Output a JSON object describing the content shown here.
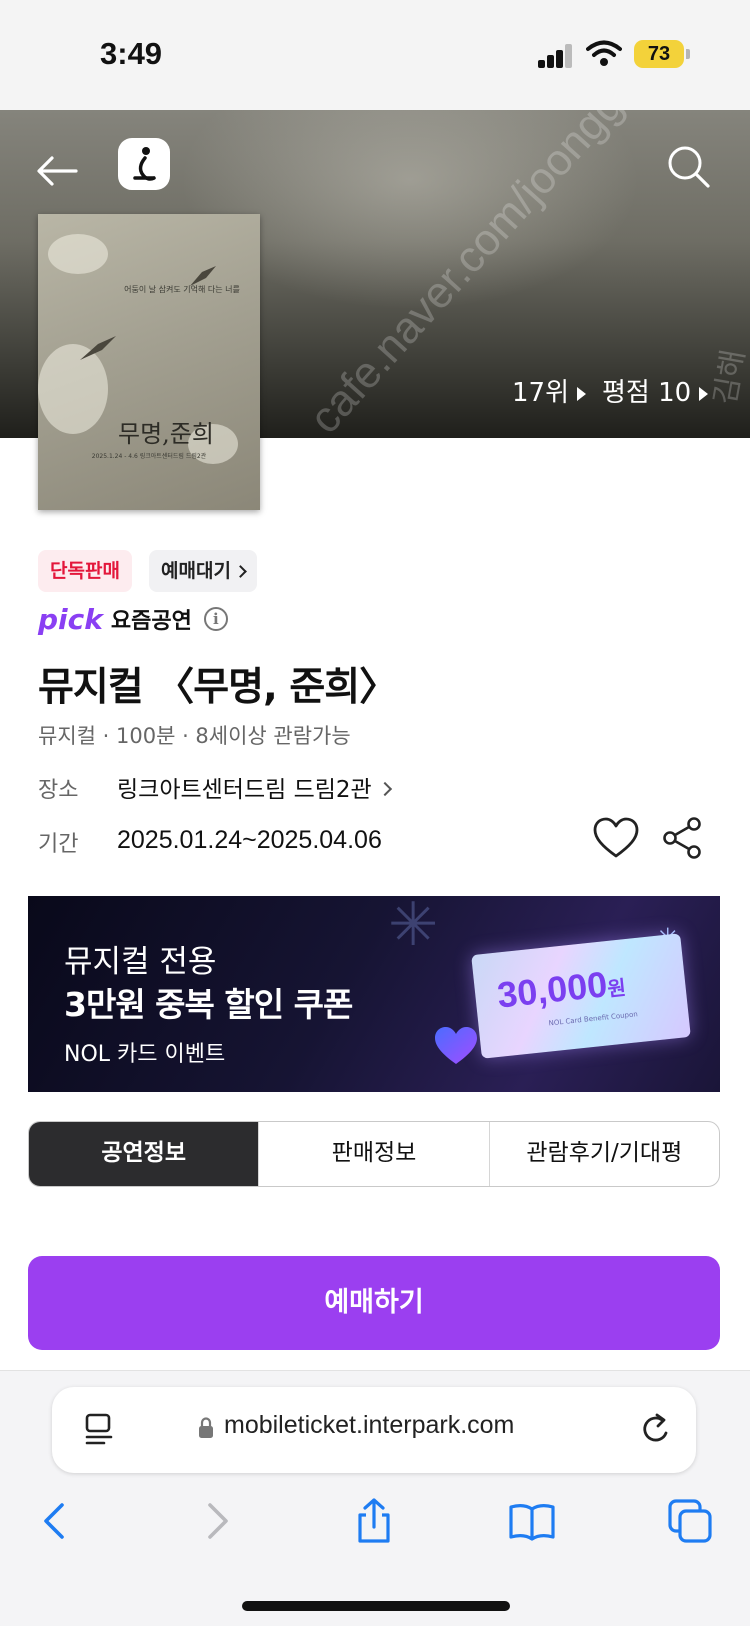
{
  "status_bar": {
    "time": "3:49",
    "battery": "73"
  },
  "header": {
    "rank": "17위",
    "rating": "평점 10"
  },
  "poster": {
    "tagline": "어둠이 날 삼켜도 기억해 다는 너를",
    "title": "무명,준희",
    "details": "2025.1.24 - 4.6 링크아트센터드림 드림2관"
  },
  "badges": {
    "exclusive": "단독판매",
    "waitlist": "예매대기"
  },
  "pick": {
    "logo": "pick",
    "label": "요즘공연",
    "info": "i"
  },
  "show": {
    "title": "뮤지컬 〈무명, 준희〉",
    "meta": "뮤지컬 · 100분 · 8세이상 관람가능",
    "venue_label": "장소",
    "venue": "링크아트센터드림 드림2관",
    "period_label": "기간",
    "period": "2025.01.24~2025.04.06"
  },
  "banner": {
    "subtitle": "뮤지컬 전용",
    "main": "3만원 중복 할인 쿠폰",
    "event": "NOL 카드 이벤트",
    "coupon_amount": "30,000",
    "coupon_unit": "원",
    "coupon_caption": "NOL Card Benefit Coupon"
  },
  "tabs": [
    {
      "label": "공연정보",
      "active": true
    },
    {
      "label": "판매정보",
      "active": false
    },
    {
      "label": "관람후기/기대평",
      "active": false
    }
  ],
  "book_button": "예매하기",
  "browser": {
    "url": "mobileticket.interpark.com"
  },
  "watermark": {
    "hero": "cafe.naver.com/joonggonara",
    "side": "김해"
  },
  "colors": {
    "brand_purple": "#9b3ff0",
    "exclusive_red": "#e3173b",
    "ios_blue": "#1e7cf2",
    "active_tab": "#2c2c2e"
  },
  "icons": [
    "back-arrow-icon",
    "app-logo-icon",
    "search-icon",
    "heart-icon",
    "share-icon",
    "info-icon",
    "reader-icon",
    "lock-icon",
    "reload-icon",
    "browser-back-icon",
    "browser-forward-icon",
    "share-sheet-icon",
    "bookmarks-icon",
    "tabs-icon"
  ]
}
